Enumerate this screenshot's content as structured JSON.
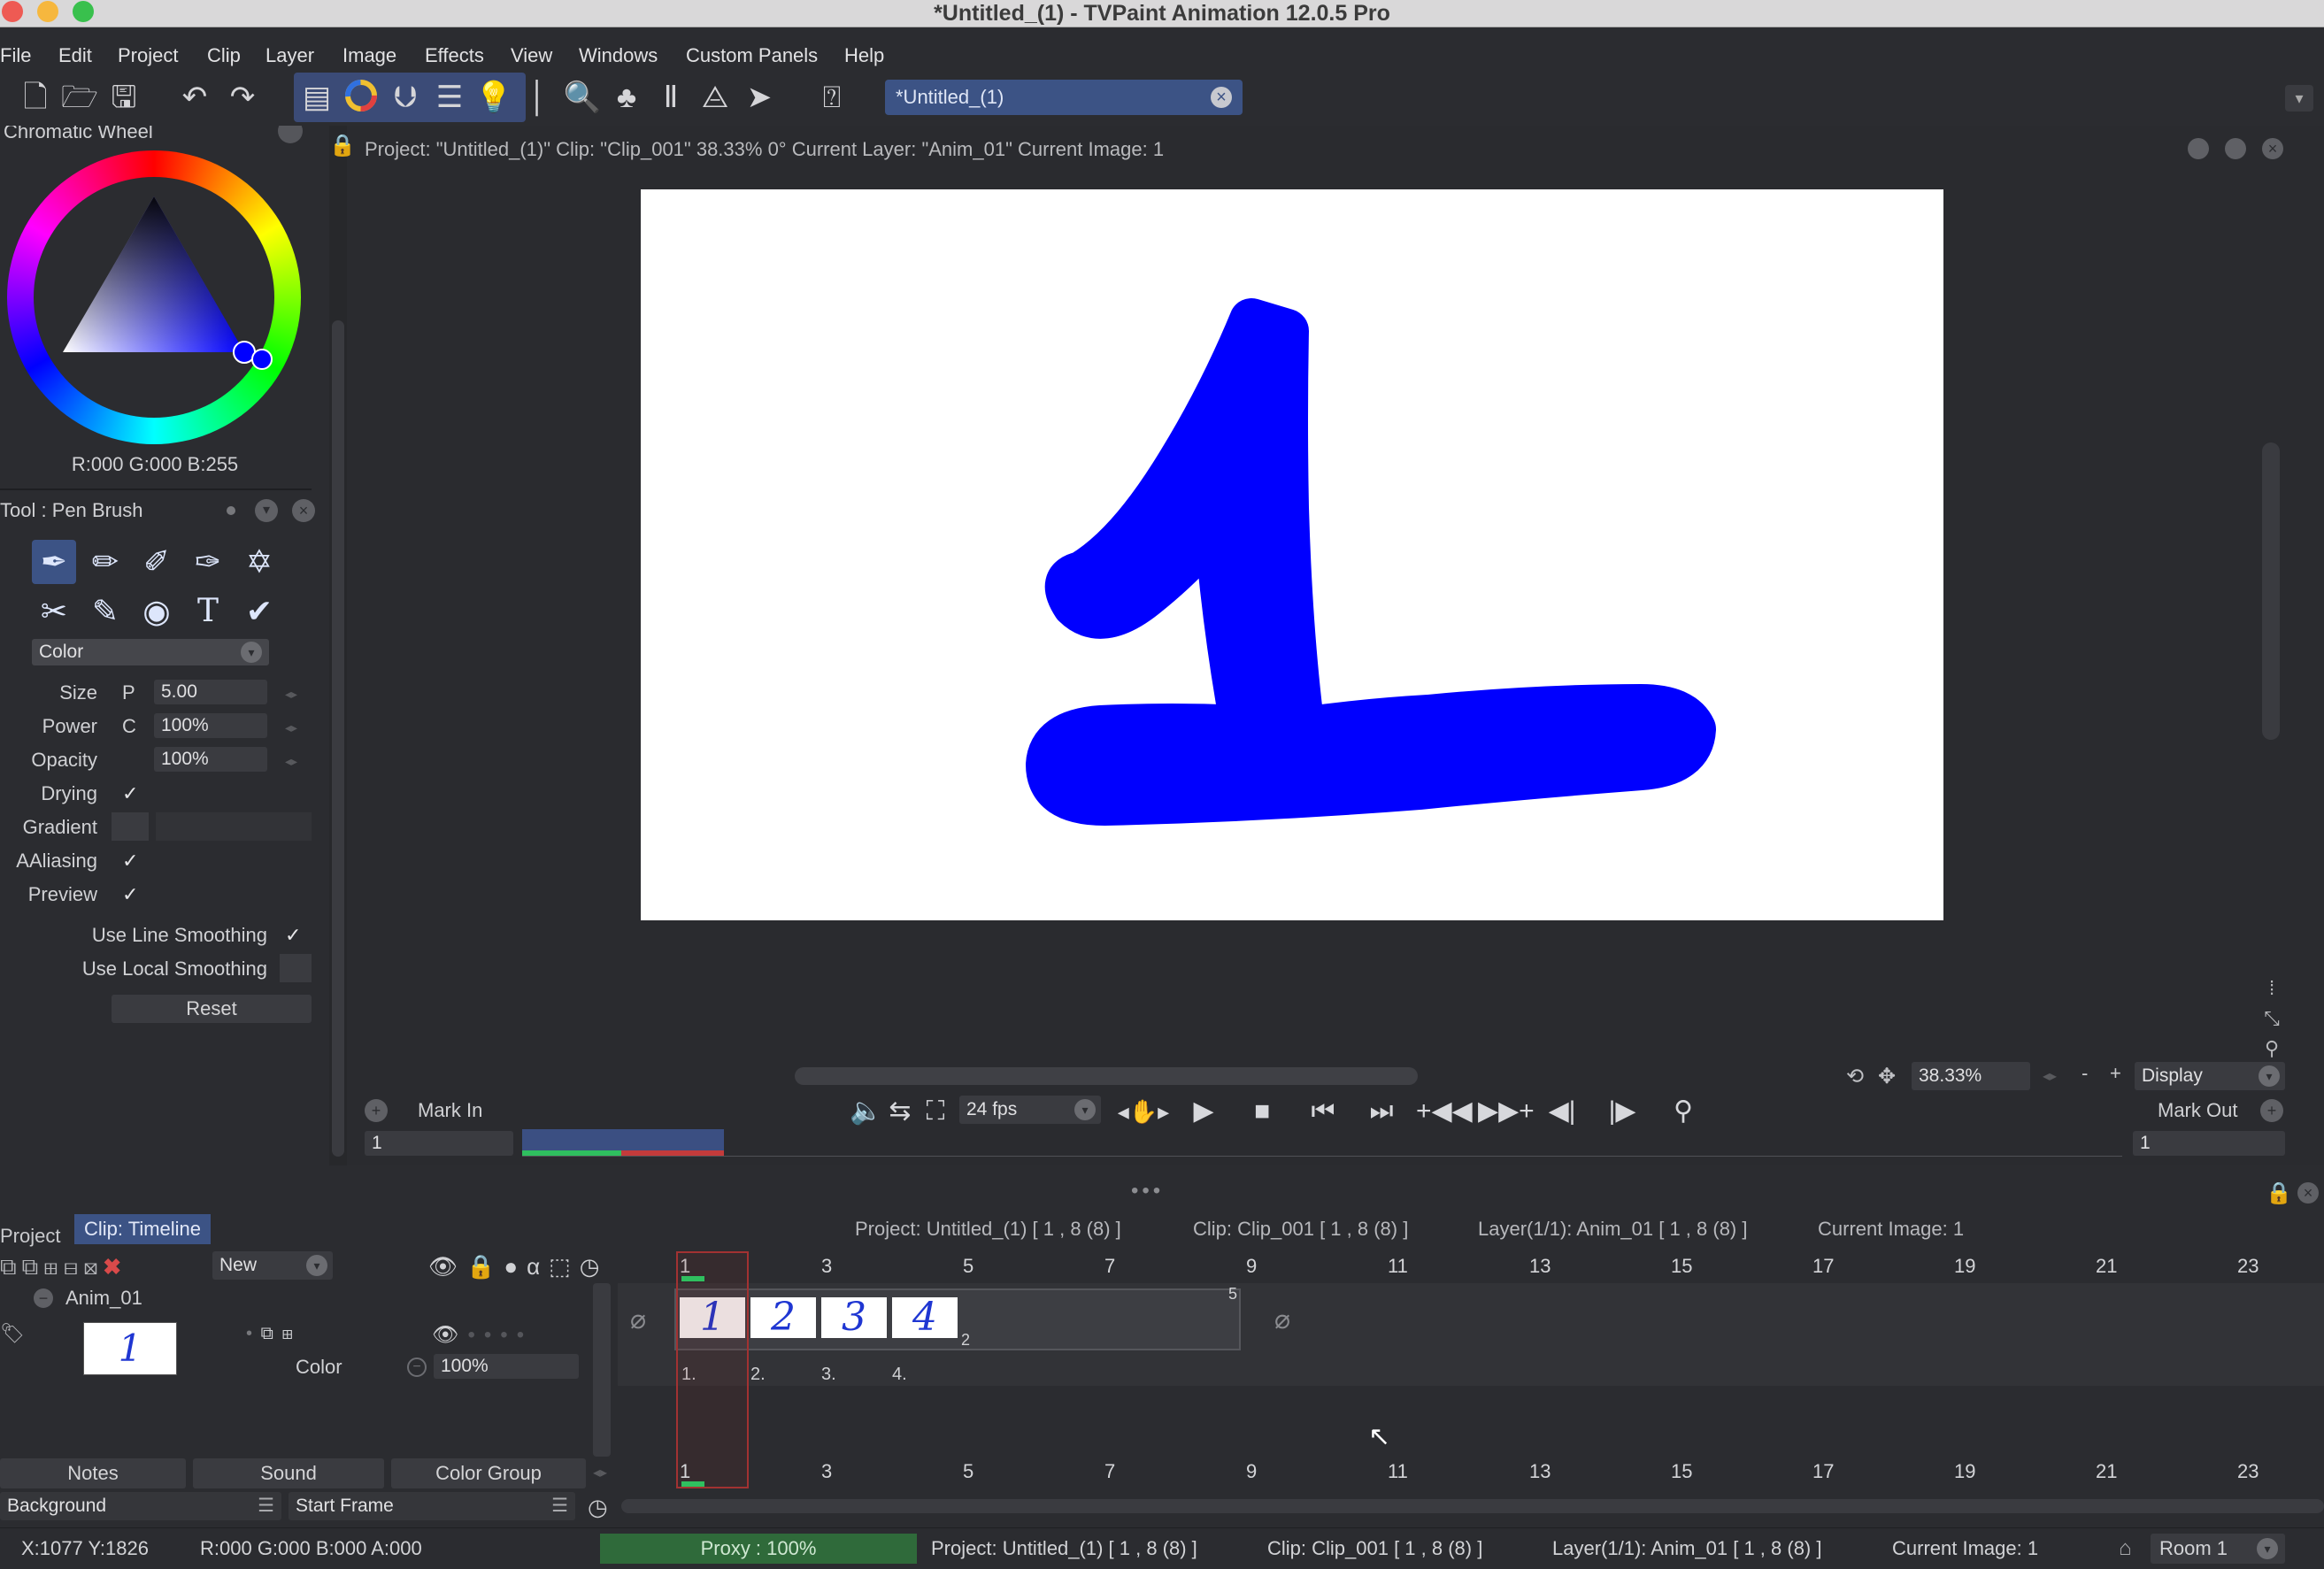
{
  "window": {
    "title": "*Untitled_(1) - TVPaint Animation 12.0.5 Pro",
    "traffic_colors": [
      "#ee5a53",
      "#f6b73e",
      "#39c04d"
    ]
  },
  "menu": [
    "File",
    "Edit",
    "Project",
    "Clip",
    "Layer",
    "Image",
    "Effects",
    "View",
    "Windows",
    "Custom Panels",
    "Help"
  ],
  "toolbar": {
    "icons": [
      "new-file-icon",
      "open-file-icon",
      "save-icon",
      "undo-icon",
      "redo-icon",
      "toolbox-icon",
      "color-wheel-icon",
      "layers-icon",
      "stack-icon",
      "lightbulb-icon",
      "ruler-icon",
      "magnifier-icon",
      "tree-icon",
      "library-icon",
      "chart-icon",
      "plane-icon",
      "help-icon"
    ],
    "doc_tab": "*Untitled_(1)"
  },
  "color_panel": {
    "title": "Chromatic Wheel",
    "rgb_readout": "R:000 G:000 B:255"
  },
  "tool_panel": {
    "title": "Tool : Pen Brush",
    "mode": "Color",
    "rows": [
      {
        "label": "Size",
        "flag": "P",
        "value": "5.00"
      },
      {
        "label": "Power",
        "flag": "C",
        "value": "100%"
      },
      {
        "label": "Opacity",
        "flag": "",
        "value": "100%"
      }
    ],
    "checks": [
      {
        "label": "Drying",
        "mark": "✓"
      },
      {
        "label": "Gradient",
        "mark": ""
      },
      {
        "label": "AAliasing",
        "mark": "✓"
      },
      {
        "label": "Preview",
        "mark": "✓"
      }
    ],
    "smoothing": [
      {
        "label": "Use Line Smoothing",
        "mark": "✓"
      },
      {
        "label": "Use Local Smoothing",
        "mark": ""
      }
    ],
    "reset": "Reset"
  },
  "project_bar": {
    "info": "Project: \"Untitled_(1)\"  Clip: \"Clip_001\"   38.33%   0°  Current Layer: \"Anim_01\"  Current Image: 1"
  },
  "canvas": {
    "glyph": "1",
    "stroke_color": "#0000ff",
    "zoom": "38.33%",
    "display_label": "Display"
  },
  "playback": {
    "mark_in": "Mark In",
    "mark_out": "Mark Out",
    "fps": "24 fps",
    "in_value": "1",
    "out_value": "1"
  },
  "timeline_header": {
    "tabs": [
      "Project",
      "Clip: Timeline"
    ],
    "project": "Project: Untitled_(1) [ 1 , 8  (8) ]",
    "clip": "Clip: Clip_001 [ 1 , 8  (8) ]",
    "layer": "Layer(1/1): Anim_01 [ 1 , 8  (8) ]",
    "current": "Current Image: 1",
    "new_label": "New",
    "ruler": [
      "1",
      "3",
      "5",
      "7",
      "9",
      "11",
      "13",
      "15",
      "17",
      "19",
      "21",
      "23"
    ]
  },
  "layer": {
    "name": "Anim_01",
    "thumb": "1",
    "mode": "Color",
    "opacity": "100%",
    "frames": [
      "1",
      "2",
      "3",
      "4"
    ],
    "frame_labels": [
      "1.",
      "2.",
      "3.",
      "4."
    ],
    "end_marker": "5",
    "hold_marker": "2"
  },
  "bottom_tabs": [
    "Notes",
    "Sound",
    "Color Group"
  ],
  "bottom_fields": {
    "background": "Background",
    "start_frame": "Start Frame"
  },
  "status": {
    "coords": "X:1077  Y:1826",
    "rgba": "R:000 G:000 B:000 A:000",
    "proxy": "Proxy : 100%",
    "project": "Project: Untitled_(1) [ 1 , 8  (8) ]",
    "clip": "Clip: Clip_001 [ 1 , 8  (8) ]",
    "layer": "Layer(1/1): Anim_01 [ 1 , 8  (8) ]",
    "current": "Current Image: 1",
    "room": "Room 1"
  }
}
